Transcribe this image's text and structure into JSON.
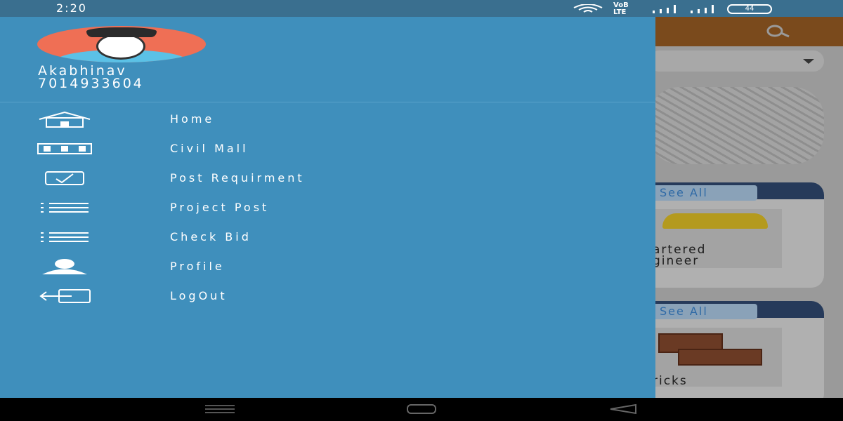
{
  "status": {
    "time": "2:20",
    "network_label": "VoB LTE",
    "battery_level": "44"
  },
  "user": {
    "name": "Akabhinav",
    "phone": "7014933604"
  },
  "menu": [
    {
      "label": "Home",
      "icon": "home-icon"
    },
    {
      "label": "Civil Mall",
      "icon": "mall-icon"
    },
    {
      "label": "Post Requirment",
      "icon": "post-requirement-icon"
    },
    {
      "label": "Project Post",
      "icon": "list-icon"
    },
    {
      "label": "Check Bid",
      "icon": "list-icon"
    },
    {
      "label": "Profile",
      "icon": "person-icon"
    },
    {
      "label": "LogOut",
      "icon": "logout-icon"
    }
  ],
  "background": {
    "see_all_1": "See All",
    "card1_line1": "artered",
    "card1_line2": "gineer",
    "see_all_2": "See All",
    "card2_line1": "ricks"
  },
  "colors": {
    "drawer": "#3f8fbc",
    "status_bar": "#3a6f8f",
    "avatar_bg": "#ef6f55",
    "toolbar": "#7a4a1c"
  }
}
